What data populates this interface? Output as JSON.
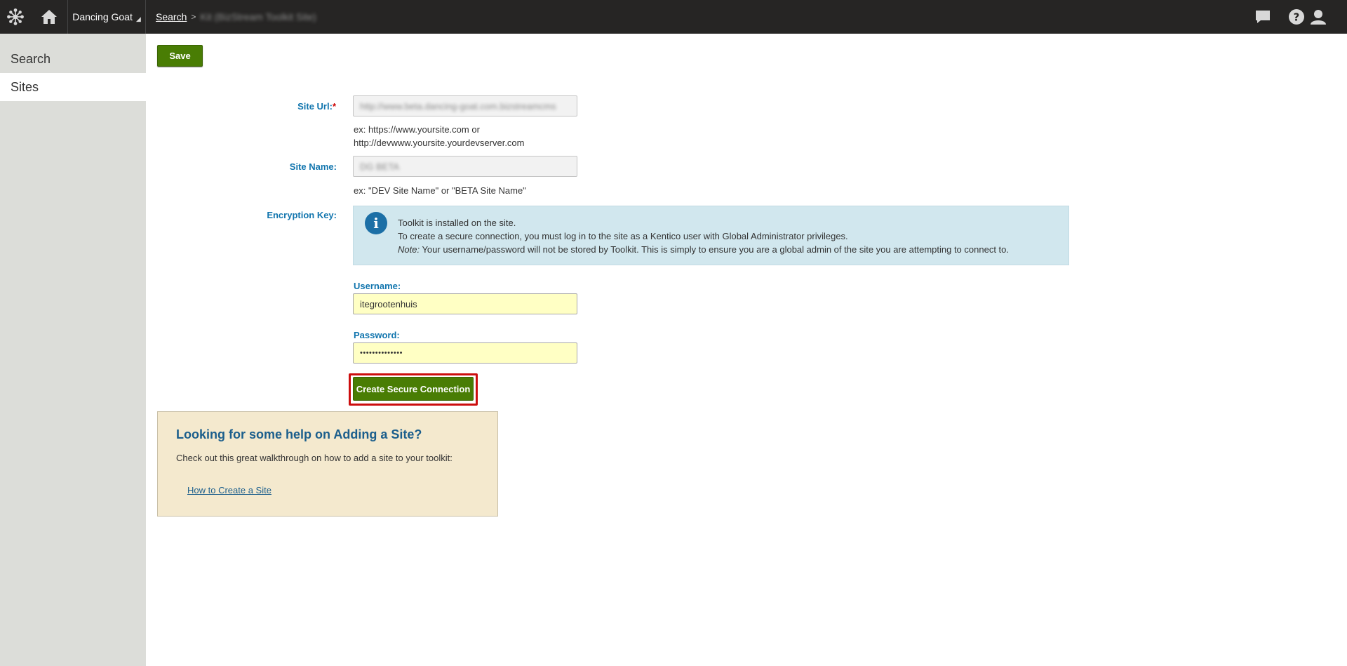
{
  "header": {
    "site_selector": "Dancing Goat",
    "breadcrumb_link": "Search",
    "breadcrumb_current": "Kit (BizStream Toolkit Site)"
  },
  "sidebar": {
    "items": [
      {
        "label": "Search",
        "active": false
      },
      {
        "label": "Sites",
        "active": true
      }
    ]
  },
  "toolbar": {
    "save_label": "Save"
  },
  "form": {
    "site_url": {
      "label": "Site Url:",
      "required_mark": "*",
      "value": "http://www.beta.dancing-goat.com.bizstreamcms",
      "hint_line1": "ex: https://www.yoursite.com or",
      "hint_line2": "http://devwww.yoursite.yourdevserver.com"
    },
    "site_name": {
      "label": "Site Name:",
      "value": "DG BETA",
      "hint": "ex: \"DEV Site Name\" or \"BETA Site Name\""
    },
    "encryption_key": {
      "label": "Encryption Key:"
    },
    "info": {
      "line1": "Toolkit is installed on the site.",
      "line2": "To create a secure connection, you must log in to the site as a Kentico user with Global Administrator privileges.",
      "note_label": "Note:",
      "note_text": " Your username/password will not be stored by Toolkit. This is simply to ensure you are a global admin of the site you are attempting to connect to."
    },
    "username": {
      "label": "Username:",
      "value": "itegrootenhuis"
    },
    "password": {
      "label": "Password:",
      "value": "••••••••••••••"
    },
    "create_button": "Create Secure Connection"
  },
  "help": {
    "title": "Looking for some help on Adding a Site?",
    "text": "Check out this great walkthrough on how to add a site to your toolkit:",
    "link": "How to Create a Site"
  }
}
